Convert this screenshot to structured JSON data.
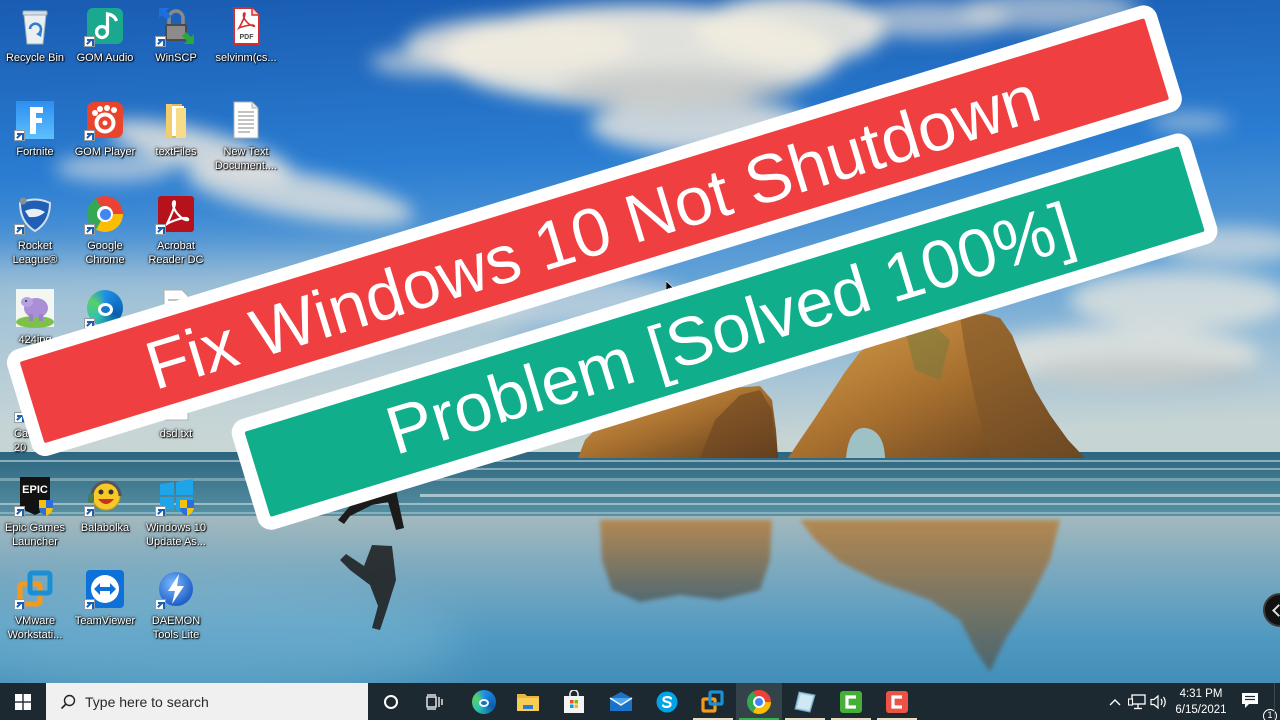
{
  "thumbnail_overlay": {
    "headline_line1": "Fix Windows 10 Not Shutdown",
    "headline_line2": "Problem [Solved 100%]",
    "banner1_color": "#f03f40",
    "banner2_color": "#11ae8c",
    "border_color": "#ffffff",
    "text_color": "#ffffff"
  },
  "desktop": {
    "icons": [
      {
        "label": "Recycle Bin",
        "icon": "recycle-bin-icon",
        "shortcut": false
      },
      {
        "label": "GOM Audio",
        "icon": "gom-audio-icon",
        "shortcut": true
      },
      {
        "label": "WinSCP",
        "icon": "winscp-icon",
        "shortcut": true
      },
      {
        "label": "selvinm(cs...",
        "icon": "pdf-file-icon",
        "shortcut": false,
        "badge": "PDF"
      },
      {
        "label": "Fortnite",
        "icon": "fortnite-icon",
        "shortcut": true
      },
      {
        "label": "GOM Player",
        "icon": "gom-player-icon",
        "shortcut": true
      },
      {
        "label": "textFiles",
        "icon": "folder-icon",
        "shortcut": false
      },
      {
        "label": "New Text\nDocument....",
        "icon": "text-document-icon",
        "shortcut": false
      },
      {
        "label": "Rocket\nLeague®",
        "icon": "rocket-league-icon",
        "shortcut": true
      },
      {
        "label": "Google\nChrome",
        "icon": "chrome-icon",
        "shortcut": true
      },
      {
        "label": "Acrobat\nReader DC",
        "icon": "acrobat-reader-icon",
        "shortcut": true
      },
      {
        "label": "424jpg",
        "icon": "image-file-icon",
        "shortcut": false
      },
      {
        "label": "",
        "icon": "edge-icon",
        "shortcut": true
      },
      {
        "label": "",
        "icon": "text-document-icon",
        "shortcut": false
      },
      {
        "label": "Ca\n20",
        "icon": "app-icon",
        "shortcut": true
      },
      {
        "label": "dsd.txt",
        "icon": "text-document-icon",
        "shortcut": false
      },
      {
        "label": "Epic Games\nLauncher",
        "icon": "epic-games-icon",
        "shortcut": true,
        "badge": "EPIC"
      },
      {
        "label": "Balabolka",
        "icon": "balabolka-icon",
        "shortcut": true
      },
      {
        "label": "Windows 10\nUpdate As...",
        "icon": "windows-update-assistant-icon",
        "shortcut": true
      },
      {
        "label": "VMware\nWorkstati...",
        "icon": "vmware-icon",
        "shortcut": true
      },
      {
        "label": "TeamViewer",
        "icon": "teamviewer-icon",
        "shortcut": true
      },
      {
        "label": "DAEMON\nTools Lite",
        "icon": "daemon-tools-icon",
        "shortcut": true
      }
    ]
  },
  "taskbar": {
    "search_placeholder": "Type here to search",
    "pinned": [
      {
        "icon": "edge-icon",
        "running": false,
        "active": false
      },
      {
        "icon": "file-explorer-icon",
        "running": false,
        "active": false
      },
      {
        "icon": "microsoft-store-icon",
        "running": false,
        "active": false
      },
      {
        "icon": "mail-icon",
        "running": false,
        "active": false
      },
      {
        "icon": "skype-icon",
        "running": false,
        "active": false
      },
      {
        "icon": "vmware-icon",
        "running": true,
        "active": false
      },
      {
        "icon": "chrome-icon",
        "running": true,
        "active": true
      },
      {
        "icon": "notes-app-icon",
        "running": true,
        "active": false
      },
      {
        "icon": "camtasia-icon",
        "running": true,
        "active": false
      },
      {
        "icon": "camtasia-recorder-icon",
        "running": true,
        "active": false
      }
    ],
    "tray": {
      "time": "4:31 PM",
      "date": "6/15/2021",
      "notification_count": "1"
    },
    "colors": {
      "background": "#1d2930",
      "search_box": "#f0f0f0",
      "running_indicator": "#e8dcc3",
      "active_indicator": "#35b548"
    }
  }
}
